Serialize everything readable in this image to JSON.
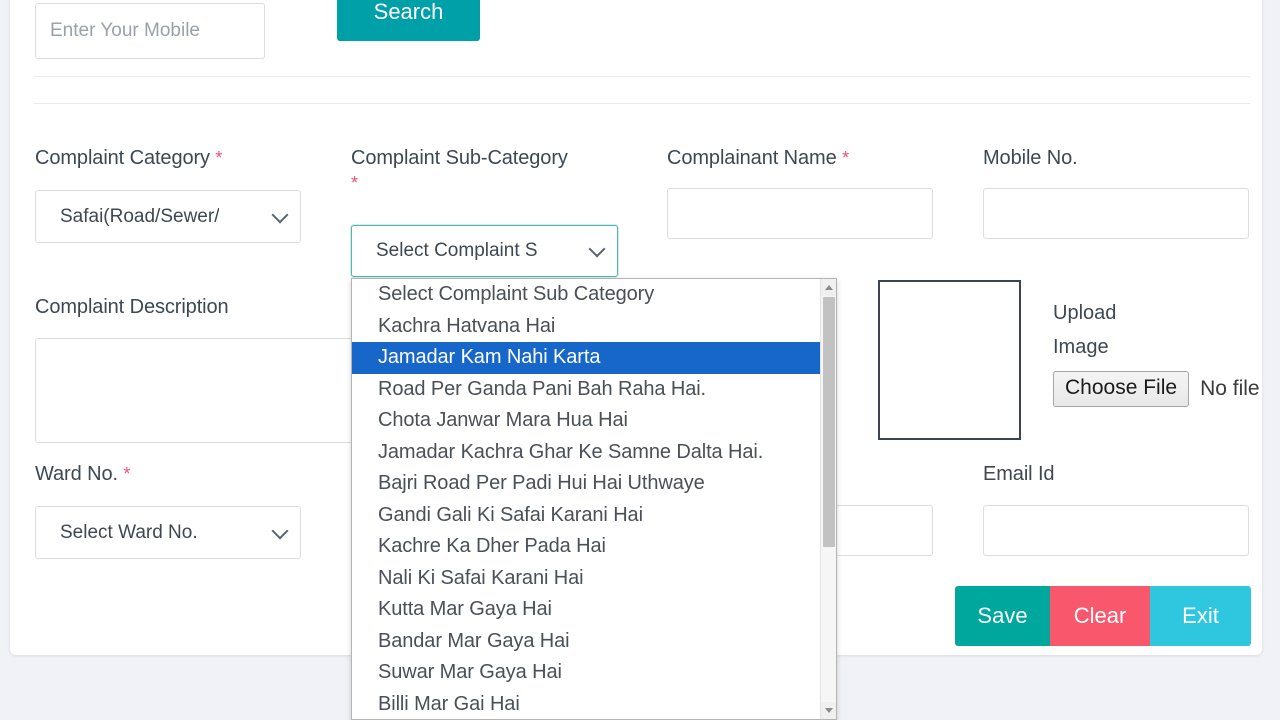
{
  "page": {
    "background_color": "#f1f2f7",
    "card_color": "#ffffff"
  },
  "search_bar": {
    "mobile_placeholder": "Enter Your Mobile",
    "mobile_value": "",
    "search_label": "Search",
    "search_color": "#00a0a8"
  },
  "form": {
    "complaint_category": {
      "label": "Complaint Category",
      "required_mark": "*",
      "value": "Safai(Road/Sewer/"
    },
    "complaint_sub_category": {
      "label": "Complaint Sub-Category",
      "required_mark": "*",
      "value": "Select Complaint S",
      "focus_color": "#4fb8ae"
    },
    "complainant_name": {
      "label": "Complainant Name",
      "required_mark": "*",
      "value": ""
    },
    "mobile_no": {
      "label": "Mobile No.",
      "value": ""
    },
    "complaint_description": {
      "label": "Complaint Description",
      "value": ""
    },
    "ward_no": {
      "label": "Ward No.",
      "required_mark": "*",
      "value": "Select Ward No."
    },
    "email_id": {
      "label": "Email Id",
      "value": ""
    },
    "upload_image": {
      "label_line1": "Upload",
      "label_line2": "Image",
      "choose_file_label": "Choose File",
      "file_status": "No file"
    }
  },
  "dropdown": {
    "open": true,
    "selected_index": 2,
    "highlight_color": "#1766ca",
    "options": [
      "Select Complaint Sub Category",
      "Kachra Hatvana Hai",
      "Jamadar Kam Nahi Karta",
      "Road Per Ganda Pani Bah Raha Hai.",
      "Chota Janwar Mara Hua Hai",
      "Jamadar Kachra Ghar Ke Samne Dalta Hai.",
      "Bajri Road Per Padi Hui Hai Uthwaye",
      "Gandi Gali Ki Safai Karani Hai",
      "Kachre Ka Dher Pada Hai",
      "Nali Ki Safai Karani Hai",
      "Kutta Mar Gaya Hai",
      "Bandar Mar Gaya Hai",
      "Suwar Mar Gaya Hai",
      "Billi Mar Gai Hai"
    ]
  },
  "actions": {
    "save_label": "Save",
    "save_color": "#00a79d",
    "clear_label": "Clear",
    "clear_color": "#f9576c",
    "exit_label": "Exit",
    "exit_color": "#2fc6e0"
  }
}
